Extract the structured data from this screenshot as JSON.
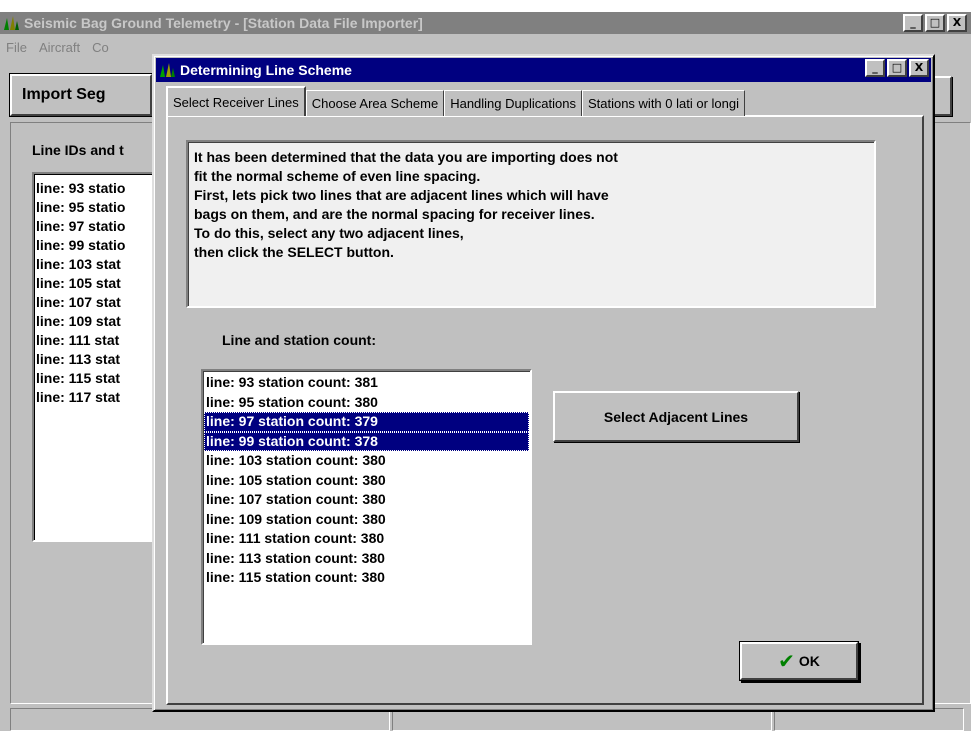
{
  "main_window": {
    "title": "Seismic Bag Ground Telemetry - [Station Data File Importer]",
    "controls": [
      "_",
      "□",
      "X"
    ],
    "menu": [
      "File",
      "Aircraft",
      "Co"
    ],
    "import_button": "Import Seg",
    "list_label": "Line IDs and t",
    "list_items": [
      "line: 93  statio",
      "line: 95  statio",
      "line: 97  statio",
      "line: 99  statio",
      "line: 103  stat",
      "line: 105  stat",
      "line: 107  stat",
      "line: 109  stat",
      "line: 111  stat",
      "line: 113  stat",
      "line: 115  stat",
      "line: 117  stat"
    ]
  },
  "dialog": {
    "title": "Determining Line Scheme",
    "controls": [
      "_",
      "□",
      "X"
    ],
    "tabs": [
      {
        "label": "Select Receiver Lines",
        "active": true
      },
      {
        "label": "Choose Area Scheme",
        "active": false
      },
      {
        "label": "Handling Duplications",
        "active": false
      },
      {
        "label": "Stations with 0 lati or longi",
        "active": false
      }
    ],
    "instructions": [
      "It has been determined that the data you are importing does not",
      "fit the normal scheme of even line spacing.",
      "First, lets pick two lines that are adjacent lines which will have",
      "bags on them, and are the normal spacing for receiver lines.",
      "To do this, select any two adjacent lines,",
      "then click the SELECT button."
    ],
    "count_label": "Line and station count:",
    "count_list": [
      {
        "text": "line: 93  station count: 381",
        "selected": false
      },
      {
        "text": "line: 95  station count: 380",
        "selected": false
      },
      {
        "text": "line: 97  station count: 379",
        "selected": true
      },
      {
        "text": "line: 99  station count: 378",
        "selected": true
      },
      {
        "text": "line: 103  station count: 380",
        "selected": false
      },
      {
        "text": "line: 105  station count: 380",
        "selected": false
      },
      {
        "text": "line: 107  station count: 380",
        "selected": false
      },
      {
        "text": "line: 109  station count: 380",
        "selected": false
      },
      {
        "text": "line: 111  station count: 380",
        "selected": false
      },
      {
        "text": "line: 113  station count: 380",
        "selected": false
      },
      {
        "text": "line: 115  station count: 380",
        "selected": false
      }
    ],
    "select_button": "Select Adjacent Lines",
    "ok_button": "OK",
    "ok_icon": "checkmark-icon"
  },
  "colors": {
    "title_active": "#000080",
    "title_inactive": "#808080",
    "face": "#c0c0c0",
    "selection": "#000080",
    "check": "#008000"
  }
}
